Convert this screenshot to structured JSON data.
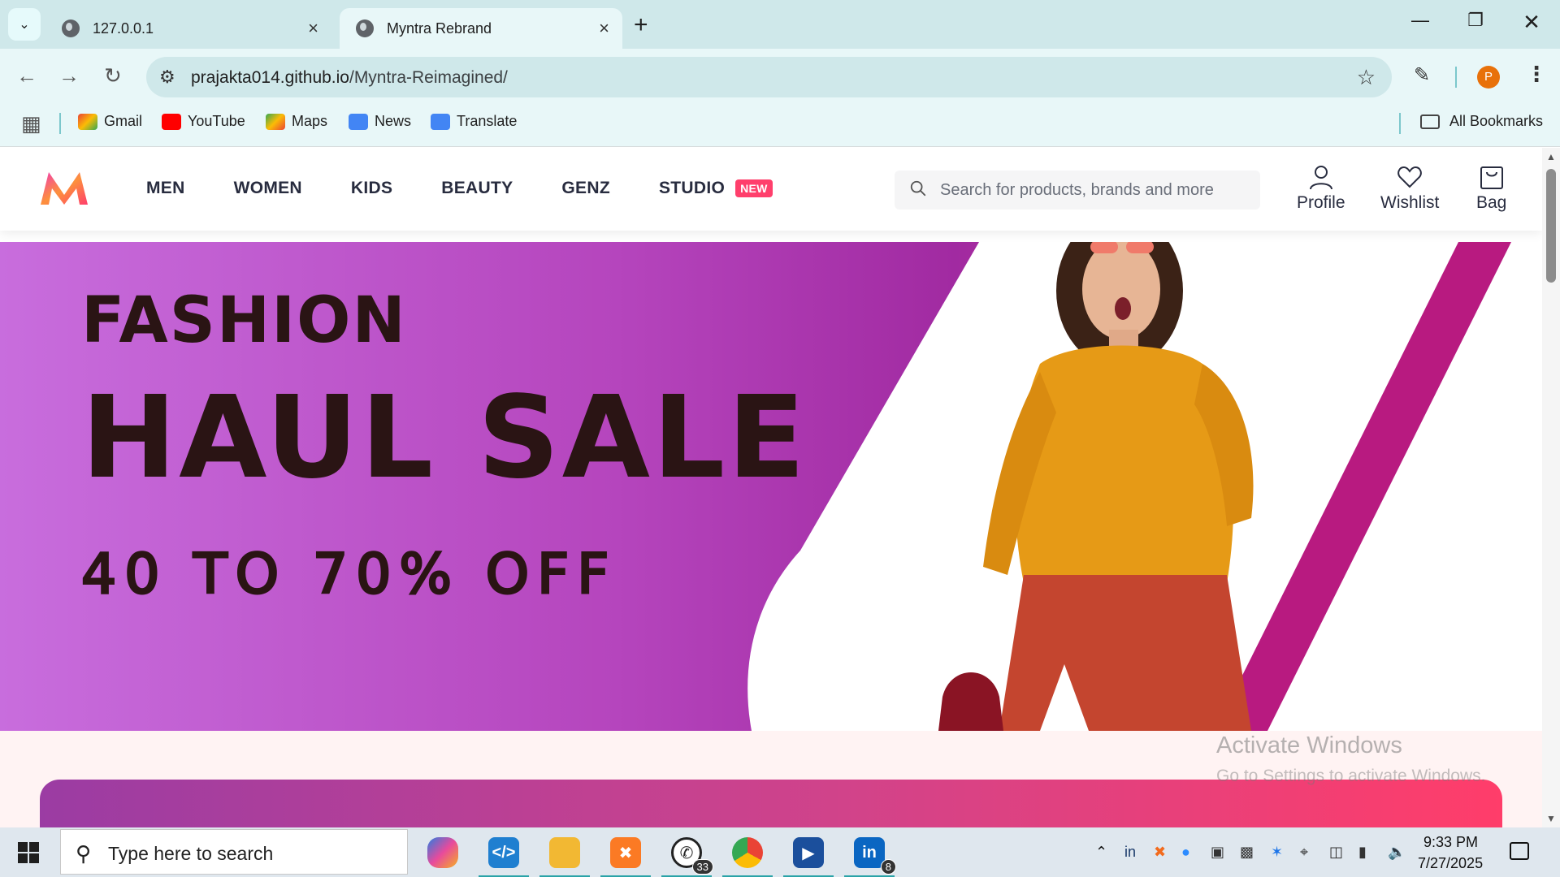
{
  "browser": {
    "tabs": [
      {
        "title": "127.0.0.1",
        "active": false
      },
      {
        "title": "Myntra Rebrand",
        "active": true
      }
    ],
    "address": {
      "host": "prajakta014.github.io",
      "path": "/Myntra-Reimagined/"
    },
    "profile_initial": "P",
    "bookmarks": [
      {
        "label": "Gmail",
        "color": "#ea4335"
      },
      {
        "label": "YouTube",
        "color": "#ff0000"
      },
      {
        "label": "Maps",
        "color": "#34a853"
      },
      {
        "label": "News",
        "color": "#4285f4"
      },
      {
        "label": "Translate",
        "color": "#4285f4"
      }
    ],
    "all_bookmarks_label": "All Bookmarks"
  },
  "site": {
    "nav": [
      {
        "label": "MEN"
      },
      {
        "label": "WOMEN"
      },
      {
        "label": "KIDS"
      },
      {
        "label": "BEAUTY"
      },
      {
        "label": "GENZ"
      },
      {
        "label": "STUDIO",
        "badge": "NEW"
      }
    ],
    "search_placeholder": "Search for products, brands and more",
    "actions": [
      {
        "label": "Profile",
        "icon": "user-icon"
      },
      {
        "label": "Wishlist",
        "icon": "heart-icon"
      },
      {
        "label": "Bag",
        "icon": "bag-icon"
      }
    ],
    "brand_colors": {
      "pink": "#ff3f6c",
      "orange": "#f89020",
      "purple": "#b545bd"
    }
  },
  "banner": {
    "line1": "FASHION",
    "line2": "HAUL SALE",
    "line3": "40 TO 70% OFF"
  },
  "watermark": {
    "title": "Activate Windows",
    "subtitle": "Go to Settings to activate Windows."
  },
  "taskbar": {
    "search_placeholder": "Type here to search",
    "apps": [
      {
        "name": "copilot",
        "badge": ""
      },
      {
        "name": "vscode",
        "badge": ""
      },
      {
        "name": "file-explorer",
        "badge": ""
      },
      {
        "name": "xampp",
        "badge": ""
      },
      {
        "name": "whatsapp",
        "badge": "33"
      },
      {
        "name": "chrome",
        "badge": ""
      },
      {
        "name": "media-player",
        "badge": ""
      },
      {
        "name": "linkedin",
        "badge": "8"
      }
    ],
    "time": "9:33 PM",
    "date": "7/27/2025"
  }
}
